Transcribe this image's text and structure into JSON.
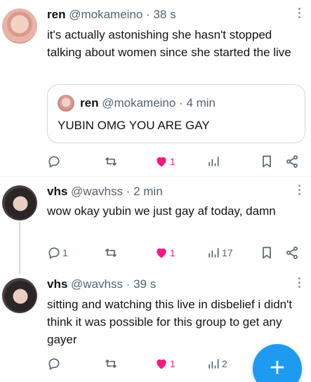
{
  "tweets": [
    {
      "name": "ren",
      "handle": "@mokameino · 38 s",
      "text": "it's actually astonishing she hasn't stopped talking about women since she started the live",
      "quote": {
        "name": "ren",
        "handle": "@mokameino · 4 min",
        "text": "YUBIN OMG YOU ARE GAY"
      },
      "replies": "",
      "retweets": "",
      "likes": "1",
      "views": ""
    },
    {
      "name": "vhs",
      "handle": "@wavhss · 2 min",
      "text": "wow okay yubin we just gay af today, damn",
      "replies": "1",
      "retweets": "",
      "likes": "1",
      "views": "17"
    },
    {
      "name": "vhs",
      "handle": "@wavhss · 39 s",
      "text": "sitting and watching this live in disbelief i didn't think it was possible for this group to get any gayer",
      "replies": "",
      "retweets": "",
      "likes": "1",
      "views": "2"
    }
  ],
  "fab": {
    "icon": "+"
  },
  "colors": {
    "accent": "#1d9bf0",
    "like": "#f91880",
    "muted": "#536471"
  },
  "icons": [
    "reply-icon",
    "retweet-icon",
    "heart-icon",
    "views-icon",
    "bookmark-icon",
    "share-icon",
    "more-icon",
    "compose-icon"
  ]
}
